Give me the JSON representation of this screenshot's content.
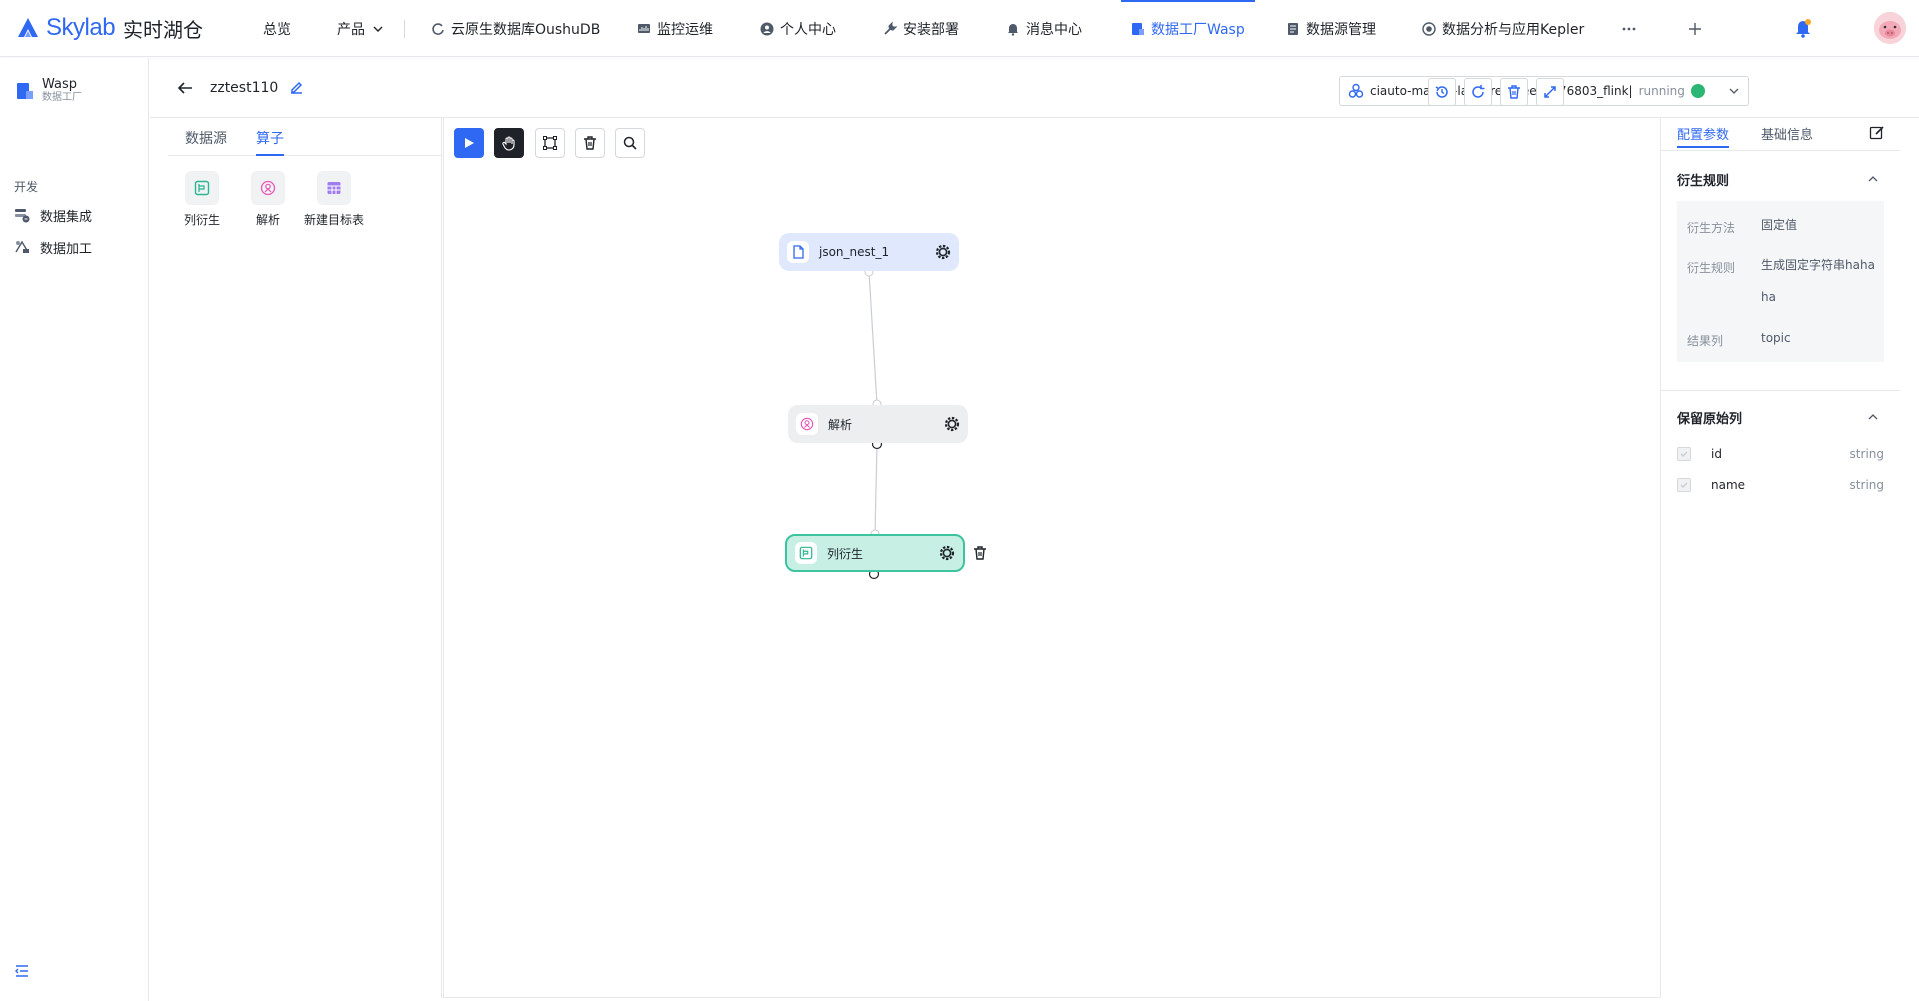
{
  "brand": {
    "logo_en": "Skylab",
    "logo_cn": "实时湖仓",
    "accent": "#2f68f2"
  },
  "topnav": [
    {
      "label": "总览"
    },
    {
      "label": "产品"
    },
    {
      "label": "云原生数据库OushuDB"
    },
    {
      "label": "监控运维"
    },
    {
      "label": "个人中心"
    },
    {
      "label": "安装部署"
    },
    {
      "label": "消息中心"
    },
    {
      "label": "数据工厂Wasp"
    },
    {
      "label": "数据源管理"
    },
    {
      "label": "数据分析与应用Kepler"
    }
  ],
  "sidebar": {
    "app_name": "Wasp",
    "app_sub": "数据工厂",
    "group": "开发",
    "items": [
      {
        "label": "数据集成"
      },
      {
        "label": "数据加工"
      }
    ]
  },
  "header": {
    "job_name": "zztest110",
    "cluster_name": "ciauto-master-lavaprepareenv576803_flink|",
    "cluster_status": "running",
    "status_color": "#2bb673"
  },
  "operator_panel": {
    "tabs": [
      {
        "label": "数据源"
      },
      {
        "label": "算子"
      }
    ],
    "active_tab": "算子",
    "cards": [
      {
        "label": "列衍生",
        "icon": "column-derive-icon"
      },
      {
        "label": "解析",
        "icon": "parse-icon"
      },
      {
        "label": "新建目标表",
        "icon": "new-table-icon"
      }
    ]
  },
  "canvas": {
    "nodes": [
      {
        "label": "json_nest_1",
        "kind": "source"
      },
      {
        "label": "解析",
        "kind": "parse"
      },
      {
        "label": "列衍生",
        "kind": "derive",
        "selected": true
      }
    ]
  },
  "config_panel": {
    "tabs": [
      {
        "label": "配置参数"
      },
      {
        "label": "基础信息"
      }
    ],
    "active_tab": "配置参数",
    "rule_section": {
      "title": "衍生规则",
      "rows": [
        {
          "key": "衍生方法",
          "value": "固定值"
        },
        {
          "key": "衍生规则",
          "value": "生成固定字符串hahaha"
        },
        {
          "key": "结果列",
          "value": "topic"
        }
      ]
    },
    "keep_section": {
      "title": "保留原始列",
      "columns": [
        {
          "name": "id",
          "type": "string"
        },
        {
          "name": "name",
          "type": "string"
        }
      ]
    }
  }
}
